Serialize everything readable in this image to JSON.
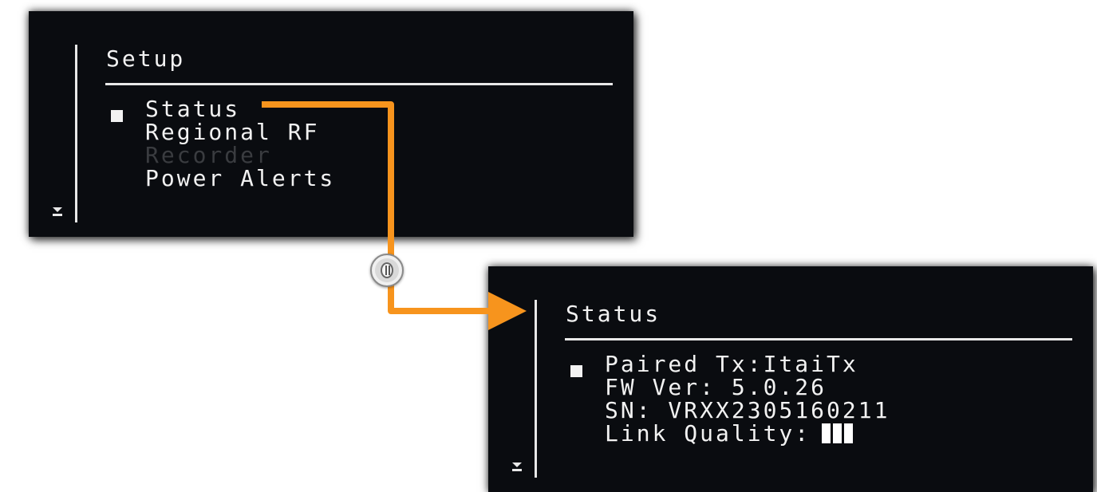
{
  "setup_screen": {
    "title": "Setup",
    "items": [
      {
        "label": "Status",
        "selected": true,
        "disabled": false
      },
      {
        "label": "Regional RF",
        "selected": false,
        "disabled": false
      },
      {
        "label": "Recorder",
        "selected": false,
        "disabled": true
      },
      {
        "label": "Power Alerts",
        "selected": false,
        "disabled": false
      }
    ],
    "scroll_icon": "scroll-down-arrow"
  },
  "status_screen": {
    "title": "Status",
    "items": [
      {
        "label": "Paired Tx:ItaiTx",
        "selected": true
      },
      {
        "label": "FW Ver: 5.0.26",
        "selected": false
      },
      {
        "label": "SN: VRXX2305160211",
        "selected": false
      },
      {
        "label": "Link Quality:",
        "selected": false
      }
    ],
    "link_quality_bars": 3,
    "scroll_icon": "scroll-down-arrow"
  },
  "connector": {
    "color": "#f7941d",
    "knob_icon": "push-knob-icon",
    "from": "Status",
    "to": "Status"
  }
}
